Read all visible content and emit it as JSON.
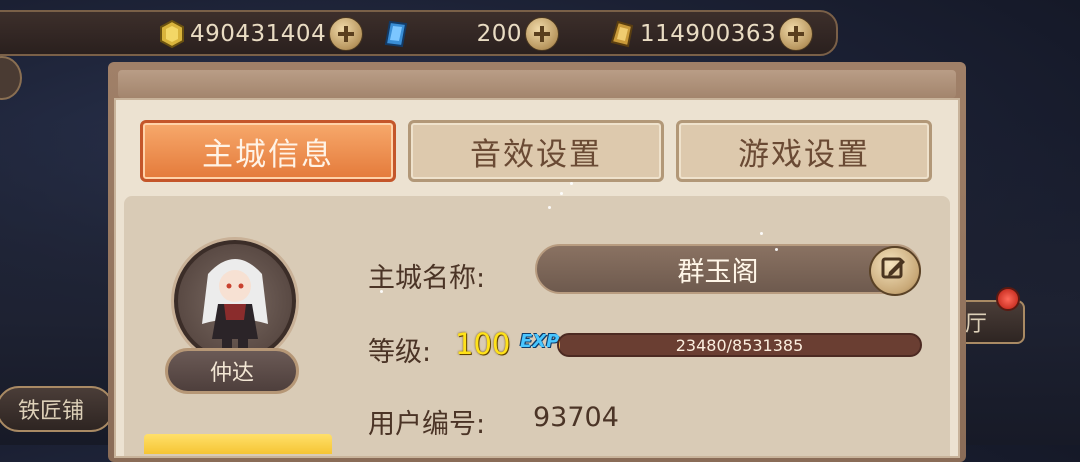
{
  "currencies": [
    {
      "icon": "gold-coin-icon",
      "value": "490431404"
    },
    {
      "icon": "blue-gem-icon",
      "value": "200"
    },
    {
      "icon": "gold-crystal-icon",
      "value": "114900363"
    }
  ],
  "tabs": [
    {
      "label": "主城信息",
      "active": true
    },
    {
      "label": "音效设置",
      "active": false
    },
    {
      "label": "游戏设置",
      "active": false
    }
  ],
  "profile": {
    "character_name": "仲达",
    "city_name_label": "主城名称:",
    "city_name": "群玉阁",
    "level_label": "等级:",
    "level": "100",
    "exp_tag": "EXP",
    "exp_text": "23480/8531385",
    "exp_progress": 0.00275,
    "user_id_label": "用户编号:",
    "user_id": "93704"
  },
  "background_buttons": {
    "left": "铁匠铺",
    "right": "厅"
  },
  "colors": {
    "active_tab": "#e47a3a",
    "level_text": "#ffe21a",
    "exp_bar": "#6a3e32"
  }
}
